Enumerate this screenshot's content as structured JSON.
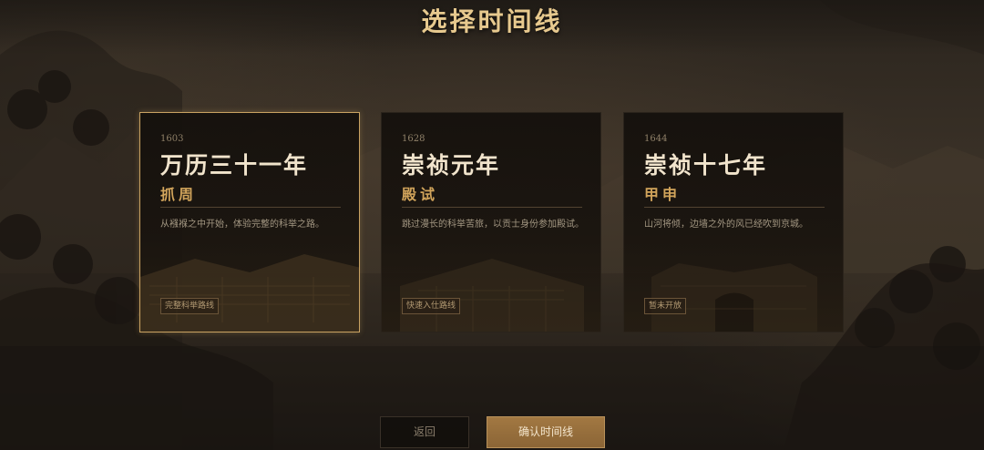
{
  "header": {
    "title": "选择时间线"
  },
  "timelines": [
    {
      "year": "1603",
      "title": "万历三十一年",
      "subtitle": "抓周",
      "description": "从襁褓之中开始，体验完整的科举之路。",
      "tag": "完整科举路线",
      "selected": true
    },
    {
      "year": "1628",
      "title": "崇祯元年",
      "subtitle": "殿试",
      "description": "跳过漫长的科举苦旅，以贡士身份参加殿试。",
      "tag": "快速入仕路线",
      "selected": false
    },
    {
      "year": "1644",
      "title": "崇祯十七年",
      "subtitle": "甲申",
      "description": "山河将倾，边墙之外的风已经吹到京城。",
      "tag": "暂未开放",
      "selected": false
    }
  ],
  "actions": {
    "back_label": "返回",
    "confirm_label": "确认时间线"
  },
  "colors": {
    "accent_gold": "#c9a262",
    "title_gold": "#e7c98e",
    "subtitle_orange": "#d1a45b",
    "confirm_bg": "#9a7240"
  }
}
